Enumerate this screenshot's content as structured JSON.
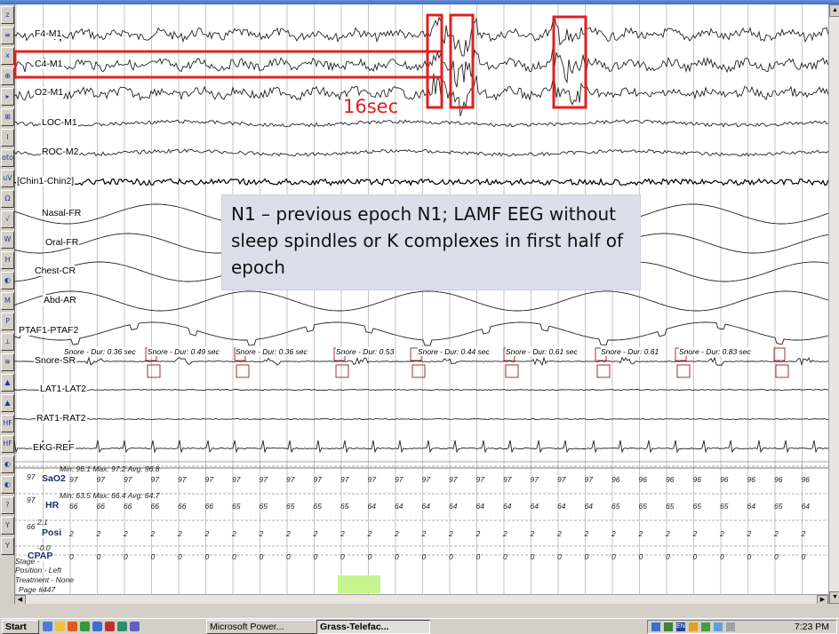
{
  "channels": [
    {
      "label": "F4-M1"
    },
    {
      "label": "C4-M1"
    },
    {
      "label": "O2-M1"
    },
    {
      "label": "LOC-M1"
    },
    {
      "label": "ROC-M2"
    },
    {
      "label": "[Chin1-Chin2]"
    },
    {
      "label": "Nasal-FR"
    },
    {
      "label": "Oral-FR"
    },
    {
      "label": "Chest-CR"
    },
    {
      "label": "Abd-AR"
    },
    {
      "label": "PTAF1-PTAF2"
    },
    {
      "label": "Snore-SR"
    },
    {
      "label": "LAT1-LAT2"
    },
    {
      "label": "RAT1-RAT2"
    },
    {
      "label": "EKG-REF"
    }
  ],
  "snore_events": [
    "Snore - Dur: 0.36 sec",
    "Snore - Dur: 0.49 sec",
    "Snore - Dur: 0.36 sec",
    "Snore - Dur: 0.53",
    "Snore - Dur: 0.44 sec",
    "Snore - Dur: 0.61 sec",
    "Snore - Dur: 0.61",
    "Snore - Dur: 0.83 sec"
  ],
  "sao2": {
    "label": "SaO2",
    "stats": "Min: 96.1 Max: 97.2 Avg: 96.8",
    "scale_top": "97",
    "values": [
      "97",
      "97",
      "97",
      "97",
      "97",
      "97",
      "97",
      "97",
      "97",
      "97",
      "97",
      "97",
      "97",
      "97",
      "97",
      "97",
      "97",
      "97",
      "97",
      "97",
      "96",
      "96",
      "96",
      "96",
      "96",
      "96",
      "96",
      "96"
    ]
  },
  "hr": {
    "label": "HR",
    "stats": "Min: 63.5 Max: 66.4 Avg: 64.7",
    "scale_top": "97",
    "values": [
      "66",
      "66",
      "66",
      "66",
      "66",
      "66",
      "65",
      "65",
      "65",
      "65",
      "65",
      "64",
      "64",
      "64",
      "64",
      "64",
      "64",
      "64",
      "64",
      "64",
      "65",
      "65",
      "65",
      "65",
      "65",
      "64",
      "65",
      "64"
    ]
  },
  "posi": {
    "label": "Posi",
    "scale_top": "66",
    "stats": "2.1",
    "values": [
      "2",
      "2",
      "2",
      "2",
      "2",
      "2",
      "2",
      "2",
      "2",
      "2",
      "2",
      "2",
      "2",
      "2",
      "2",
      "2",
      "2",
      "2",
      "2",
      "2",
      "2",
      "2",
      "2",
      "2",
      "2",
      "2",
      "2",
      "2"
    ]
  },
  "cpap": {
    "label": "CPAP",
    "stats": "-0.0",
    "values": [
      "0",
      "0",
      "0",
      "0",
      "0",
      "0",
      "0",
      "0",
      "0",
      "0",
      "0",
      "0",
      "0",
      "0",
      "0",
      "0",
      "0",
      "0",
      "0",
      "0",
      "0",
      "0",
      "0",
      "0",
      "0",
      "0",
      "0",
      "0"
    ]
  },
  "bottom_info": {
    "stage": "Stage -",
    "position": "Position - Left",
    "treatment": "Treatment - None",
    "page": "Page #447"
  },
  "annotation": {
    "label_16sec": "16sec",
    "callout": "N1 – previous epoch N1; LAMF EEG without sleep spindles or K complexes in first half of epoch"
  },
  "toolbar_left": [
    "z",
    "≡",
    "x",
    "⊕",
    "▸",
    "⊞",
    "I",
    "oto",
    "uV",
    "Ω",
    "√",
    "W",
    "H",
    "◐",
    "M",
    "P",
    "⟂",
    "≋",
    "▲",
    "▲",
    "HF",
    "HF",
    "◐",
    "◐",
    "?",
    "Y",
    "Y"
  ],
  "taskbar": {
    "start": "Start",
    "items": [
      "Microsoft Power...",
      "Grass-Telefac..."
    ],
    "clock": "7:23 PM",
    "lang": "EN"
  },
  "colors": {
    "highlight": "#e02020",
    "callout_bg": "#d9e0ea",
    "scroll_thumb": "#c6f58f"
  }
}
